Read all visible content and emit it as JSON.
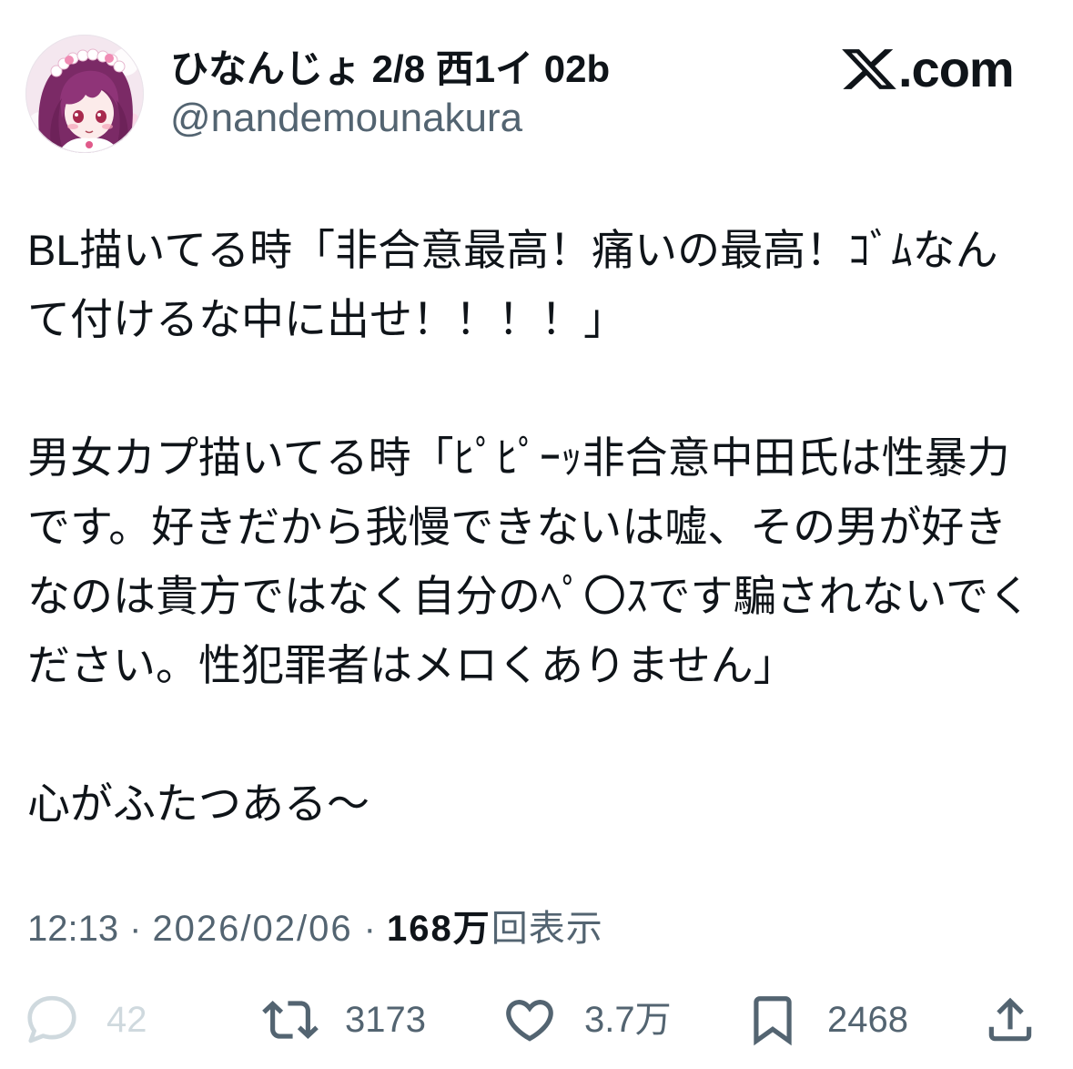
{
  "brand": {
    "logo": "𝕏",
    "domain": ".com"
  },
  "author": {
    "display_name": "ひなんじょ 2/8 西1イ 02b",
    "handle": "@nandemounakura",
    "avatar_icon": "avatar-anime-girl"
  },
  "post": {
    "paragraphs": [
      {
        "lines": [
          "BL描いてる時「非合意最高！痛いの最高！ｺﾞﾑなん",
          "て付けるな中に出せ！！！！」"
        ]
      },
      {
        "lines": [
          "男女カプ描いてる時「ﾋﾟﾋﾟｰｯ非合意中田氏は性暴力",
          "です。好きだから我慢できないは嘘、その男が好き",
          "なのは貴方ではなく自分のﾍﾟ〇ｽです騙されないでく",
          "ださい。性犯罪者はメロくありません」"
        ]
      },
      {
        "lines": [
          "心がふたつある〜"
        ]
      }
    ]
  },
  "meta": {
    "time": "12:13",
    "separator": "·",
    "date": "2026/02/06",
    "views_count": "168万",
    "views_label": "回表示"
  },
  "actions": {
    "reply": {
      "icon": "reply-icon",
      "count": "42"
    },
    "repost": {
      "icon": "repost-icon",
      "count": "3173"
    },
    "like": {
      "icon": "heart-icon",
      "count": "3.7万"
    },
    "bookmark": {
      "icon": "bookmark-icon",
      "count": "2468"
    },
    "share": {
      "icon": "share-icon"
    }
  },
  "colors": {
    "text": "#0f1419",
    "secondary": "#536471",
    "muted": "#cfd9de",
    "background": "#ffffff"
  }
}
